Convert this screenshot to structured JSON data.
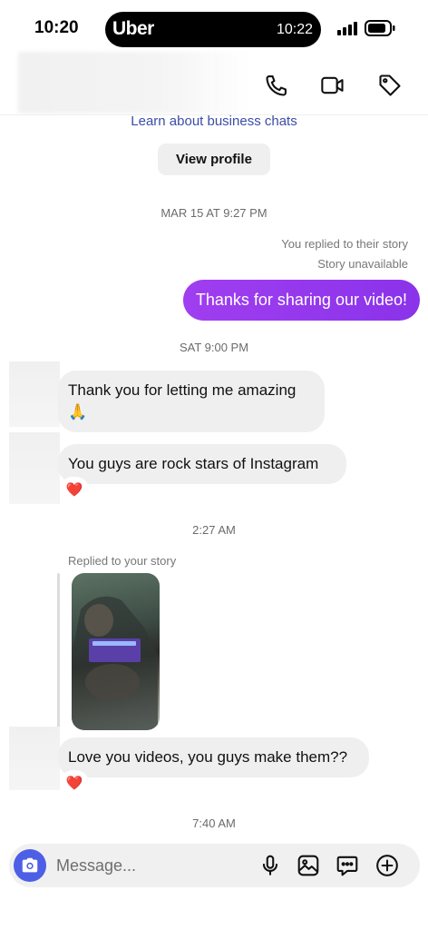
{
  "status_bar": {
    "time": "10:20",
    "island_brand": "Uber",
    "island_time": "10:22"
  },
  "header": {
    "icons": [
      "phone-icon",
      "video-icon",
      "tag-icon"
    ]
  },
  "thread": {
    "learn_link": "Learn about business chats",
    "view_profile_label": "View profile",
    "timestamps": [
      "MAR 15 AT 9:27 PM",
      "SAT 9:00 PM",
      "2:27 AM",
      "7:40 AM"
    ],
    "outgoing_reply_note": "You replied to their story",
    "story_unavailable": "Story unavailable",
    "outgoing_message": "Thanks for sharing our video!",
    "incoming_1_line1": "Thank you for letting me amazing",
    "incoming_1_emoji": "🙏",
    "incoming_2": "You guys are rock stars  of Instagram",
    "incoming_2_reaction": "❤️",
    "replied_story_note": "Replied to your story",
    "incoming_3": "Love you videos, you guys make them??",
    "incoming_3_reaction": "❤️"
  },
  "composer": {
    "placeholder": "Message...",
    "icons": [
      "camera-icon",
      "microphone-icon",
      "gallery-icon",
      "sticker-icon",
      "plus-icon"
    ]
  },
  "colors": {
    "outgoing_bubble": "#9a3cef",
    "link": "#3b4ca8",
    "camera_button": "#4c5fe6",
    "heart": "#e0122f"
  }
}
